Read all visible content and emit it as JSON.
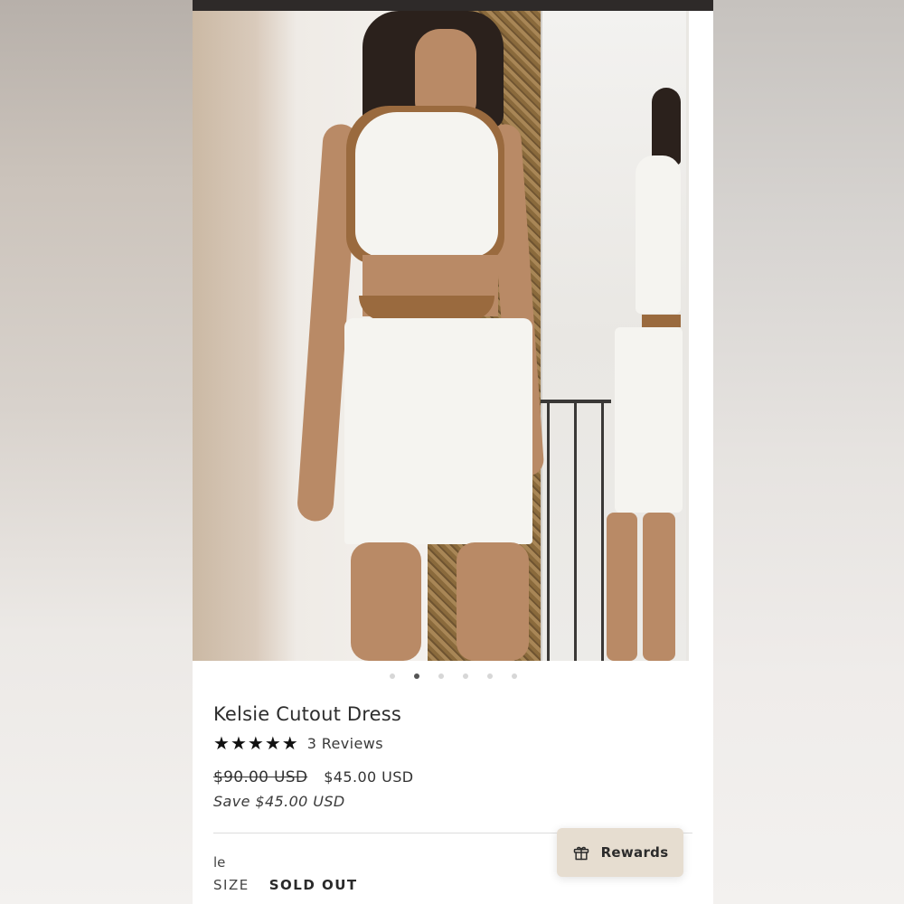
{
  "product": {
    "title": "Kelsie Cutout Dress",
    "rating": 5,
    "stars": [
      "★",
      "★",
      "★",
      "★",
      "★"
    ],
    "reviews_label": "3 Reviews",
    "original_price": "$90.00 USD",
    "sale_price": "$45.00 USD",
    "savings": "Save $45.00 USD",
    "color_label_partial": "le",
    "size_label": "SIZE",
    "size_status": "SOLD OUT"
  },
  "gallery": {
    "total_images": 6,
    "active_index": 1
  },
  "rewards": {
    "label": "Rewards",
    "icon": "gift-icon",
    "background": "#e6ddd0"
  },
  "colors": {
    "status_bar": "#2e2a29",
    "text": "#2d2d2d",
    "dot_active": "#555555",
    "dot_inactive": "#d7d7d7"
  }
}
